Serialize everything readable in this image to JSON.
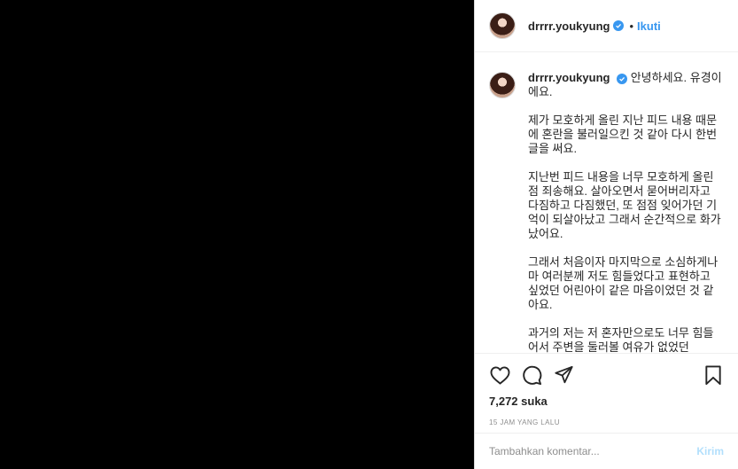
{
  "header": {
    "username": "drrrr.youkyung",
    "separator": "•",
    "follow_label": "Ikuti"
  },
  "caption": {
    "username": "drrrr.youkyung",
    "paragraphs": [
      "안녕하세요. 유경이에요.",
      "제가 모호하게 올린 지난 피드 내용 때문에 혼란을 불러일으킨 것 같아 다시 한번 글을 써요.",
      "지난번 피드 내용을 너무 모호하게 올린 점 죄송해요. 살아오면서 묻어버리자고 다짐하고 다짐했던, 또 점점 잊어가던 기억이 되살아났고 그래서 순간적으로 화가 났어요.",
      "그래서 처음이자 마지막으로 소심하게나마 여러분께 저도 힘들었다고 표현하고 싶었던 어린아이 같은 마음이었던 것 같아요.",
      "과거의 저는 저 혼자만으로도 너무 힘들어서 주변을 둘러볼 여유가 없었던"
    ]
  },
  "actions": {
    "like_icon": "heart-icon",
    "comment_icon": "comment-bubble-icon",
    "share_icon": "paper-plane-icon",
    "save_icon": "bookmark-icon"
  },
  "likes": "7,272 suka",
  "timestamp": "15 JAM YANG LALU",
  "add_comment": {
    "placeholder": "Tambahkan komentar...",
    "post_label": "Kirim"
  },
  "colors": {
    "accent": "#3897f0",
    "text": "#262626",
    "muted": "#8e8e8e",
    "post_disabled": "#b2dffc",
    "media_bg": "#000000"
  }
}
